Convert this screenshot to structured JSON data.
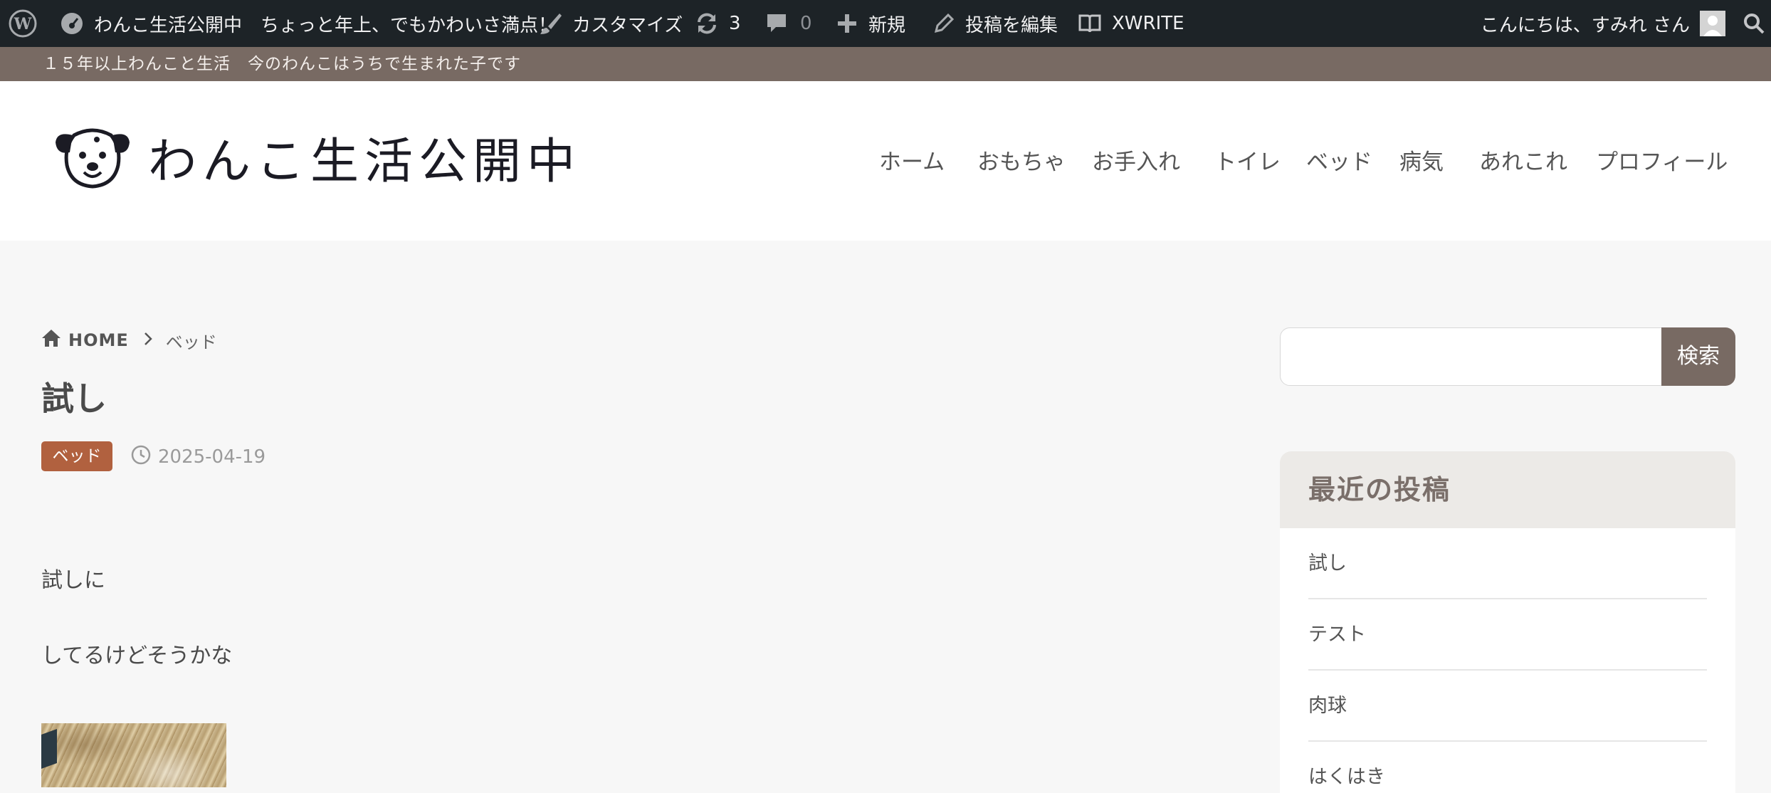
{
  "admin_bar": {
    "site_name": "わんこ生活公開中　ちょっと年上、でもかわいさ満点！",
    "customize": "カスタマイズ",
    "updates_count": "3",
    "comments_count": "0",
    "new": "新規",
    "edit_post": "投稿を編集",
    "xwrite": "XWRITE",
    "greeting": "こんにちは、すみれ さん"
  },
  "tagline": "１５年以上わんこと生活　今のわんこはうちで生まれた子です",
  "site_title": "わんこ生活公開中",
  "nav": [
    "ホーム",
    "おもちゃ",
    "お手入れ",
    "トイレ",
    "ベッド",
    "病気",
    "あれこれ",
    "プロフィール"
  ],
  "breadcrumb": {
    "home": "HOME",
    "current": "ベッド"
  },
  "post": {
    "title": "試し",
    "category": "ベッド",
    "date": "2025-04-19",
    "paragraphs": [
      "試しに",
      "してるけどそうかな"
    ]
  },
  "sidebar": {
    "search_button": "検索",
    "recent_title": "最近の投稿",
    "recent_posts": [
      "試し",
      "テスト",
      "肉球",
      "はくはき"
    ]
  },
  "colors": {
    "admin_bar_bg": "#1d2327",
    "tagline_bg": "#786a63",
    "category_badge": "#b1613f",
    "search_button_bg": "#786a63"
  }
}
